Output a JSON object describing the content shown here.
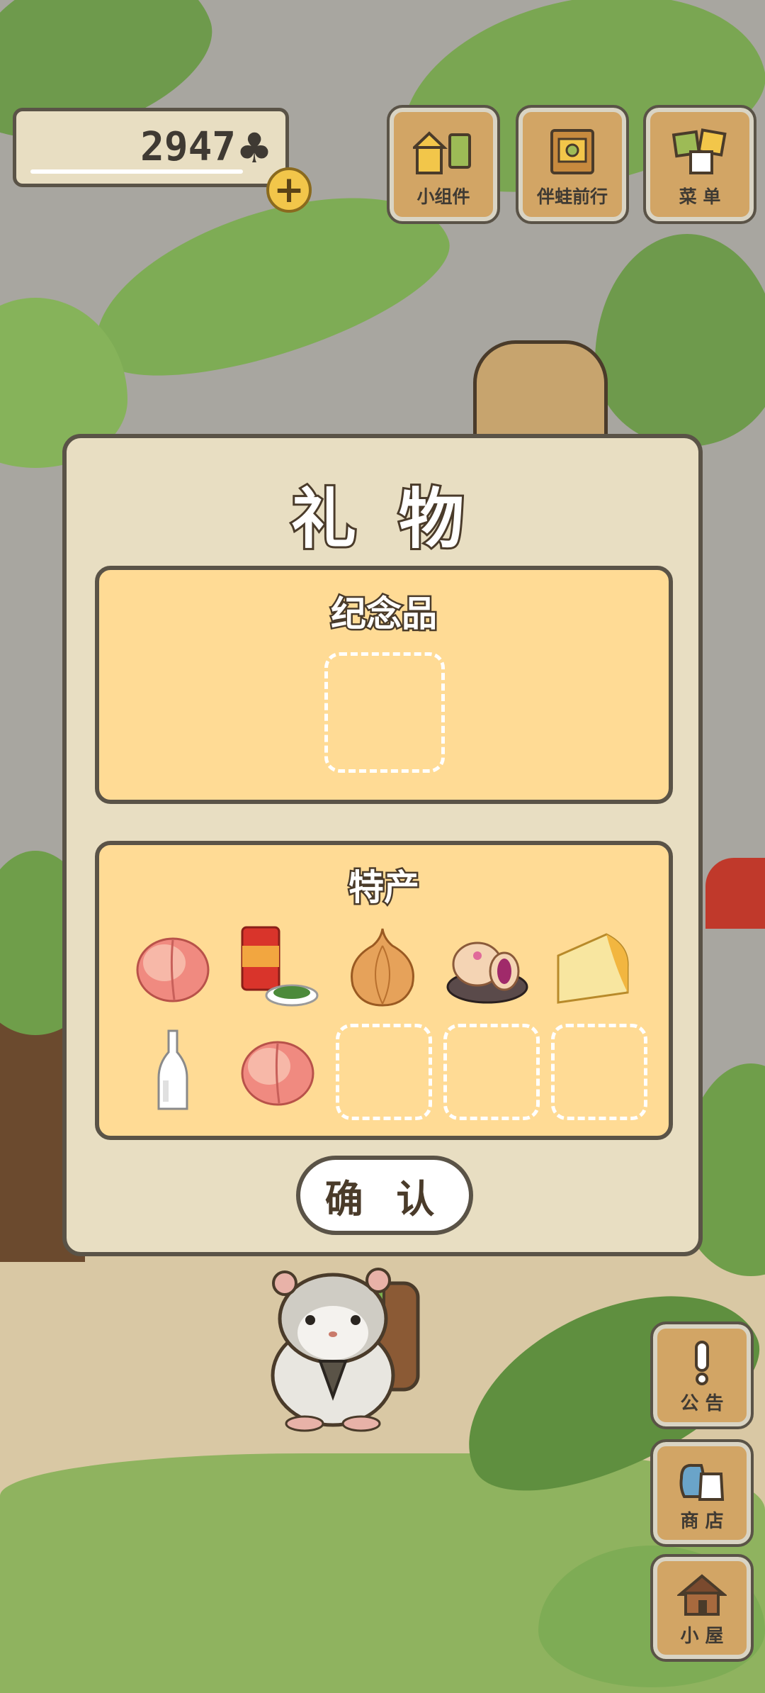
{
  "hud": {
    "clover_count": "2947",
    "clover_symbol": "♣",
    "plus_symbol": "+"
  },
  "top_buttons": [
    {
      "label": "小组件"
    },
    {
      "label": "伴蛙前行"
    },
    {
      "label": "菜 单"
    }
  ],
  "side_buttons": [
    {
      "label": "公 告"
    },
    {
      "label": "商 店"
    },
    {
      "label": "小 屋"
    }
  ],
  "dialog": {
    "title": "礼 物",
    "souvenir_title": "纪念品",
    "specialty_title": "特产",
    "specialty_items": [
      "peach",
      "canned-tea-with-greens",
      "onion",
      "flower-cake",
      "cheese",
      "glass-bottle",
      "peach"
    ],
    "confirm_label": "确 认"
  },
  "colors": {
    "dialog_bg": "#e8dec2",
    "panel_bg": "#ffdb95",
    "border": "#5a5347",
    "wood_button": "#d2a565"
  }
}
